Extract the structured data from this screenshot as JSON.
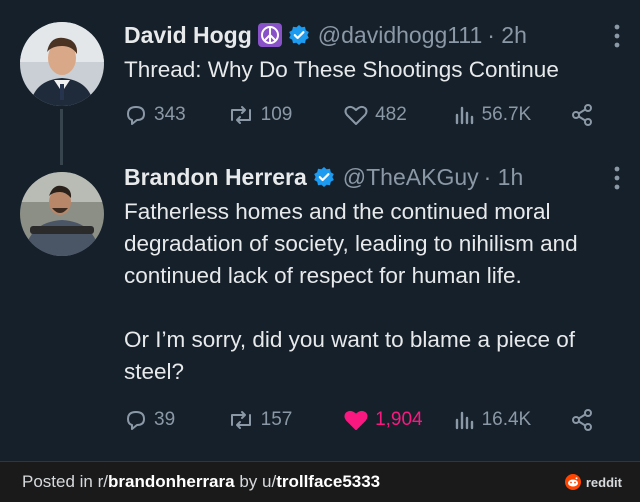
{
  "tweets": [
    {
      "name": "David Hogg",
      "emoji": "☮",
      "handle": "@davidhogg111",
      "time": "· 2h",
      "text": "Thread: Why Do These Shootings Continue",
      "replies": "343",
      "retweets": "109",
      "likes": "482",
      "views": "56.7K",
      "liked": false
    },
    {
      "name": "Brandon Herrera",
      "handle": "@TheAKGuy",
      "time": "· 1h",
      "text": "Fatherless homes and the continued moral degradation of society, leading to nihilism and continued lack of respect for human life.\n\nOr I’m sorry, did you want to blame a piece of steel?",
      "replies": "39",
      "retweets": "157",
      "likes": "1,904",
      "views": "16.4K",
      "liked": true
    }
  ],
  "footer": {
    "prefix": "Posted in r/",
    "subreddit": "brandonherrara",
    "by": " by u/",
    "user": "trollface5333",
    "brand": "reddit"
  },
  "colors": {
    "background": "#15202b",
    "verified": "#1d9bf0",
    "like": "#f91880",
    "muted": "#8b98a5",
    "reddit": "#ff4500",
    "emoji_bg": "#8a52c8"
  },
  "icons": [
    "reply-icon",
    "retweet-icon",
    "heart-icon",
    "views-icon",
    "share-icon",
    "verified-icon",
    "peace-icon",
    "more-icon",
    "reddit-icon"
  ]
}
